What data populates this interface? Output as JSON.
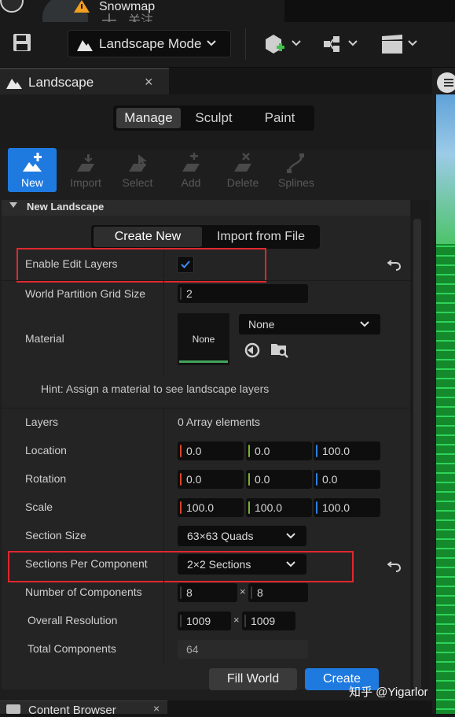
{
  "window": {
    "project_name": "Snowmap",
    "watermark_plus": "十",
    "watermark_follow": "关注"
  },
  "toolbar": {
    "mode_label": "Landscape Mode"
  },
  "panel_tab": {
    "title": "Landscape",
    "close_glyph": "×"
  },
  "mode_tabs": [
    {
      "label": "Manage",
      "active": true
    },
    {
      "label": "Sculpt",
      "active": false
    },
    {
      "label": "Paint",
      "active": false
    }
  ],
  "tools": [
    {
      "label": "New",
      "icon": "new-landscape-icon",
      "active": true
    },
    {
      "label": "Import",
      "icon": "import-icon",
      "active": false
    },
    {
      "label": "Select",
      "icon": "select-icon",
      "active": false
    },
    {
      "label": "Add",
      "icon": "add-icon",
      "active": false
    },
    {
      "label": "Delete",
      "icon": "delete-icon",
      "active": false
    },
    {
      "label": "Splines",
      "icon": "splines-icon",
      "active": false
    }
  ],
  "section": {
    "title": "New Landscape"
  },
  "source_toggle": [
    {
      "label": "Create New",
      "active": true
    },
    {
      "label": "Import from File",
      "active": false
    }
  ],
  "properties": {
    "enable_edit_layers": {
      "label": "Enable Edit Layers",
      "checked": true
    },
    "world_partition_grid_size": {
      "label": "World Partition Grid Size",
      "value": "2"
    },
    "material": {
      "label": "Material",
      "thumb": "None",
      "value": "None"
    },
    "hint": "Hint: Assign a material to see landscape layers",
    "layers": {
      "label": "Layers",
      "value": "0 Array elements"
    },
    "location": {
      "label": "Location",
      "x": "0.0",
      "y": "0.0",
      "z": "100.0"
    },
    "rotation": {
      "label": "Rotation",
      "x": "0.0",
      "y": "0.0",
      "z": "0.0"
    },
    "scale": {
      "label": "Scale",
      "x": "100.0",
      "y": "100.0",
      "z": "100.0"
    },
    "section_size": {
      "label": "Section Size",
      "value": "63×63 Quads"
    },
    "sections_per_component": {
      "label": "Sections Per Component",
      "value": "2×2 Sections"
    },
    "number_of_components": {
      "label": "Number of Components",
      "x": "8",
      "y": "8",
      "sep": "×"
    },
    "overall_resolution": {
      "label": "Overall Resolution",
      "x": "1009",
      "y": "1009",
      "sep": "×"
    },
    "total_components": {
      "label": "Total Components",
      "value": "64"
    }
  },
  "actions": {
    "fill_world": "Fill World",
    "create": "Create"
  },
  "bottom_tab": {
    "title": "Content Browser",
    "close_glyph": "×"
  },
  "watermark": "知乎 @Yigarlor",
  "colors": {
    "accent_blue": "#1f7ae0",
    "highlight_red": "#e0282e",
    "axis_x": "#d9452b",
    "axis_y": "#7ab32e",
    "axis_z": "#2f7fe0"
  }
}
